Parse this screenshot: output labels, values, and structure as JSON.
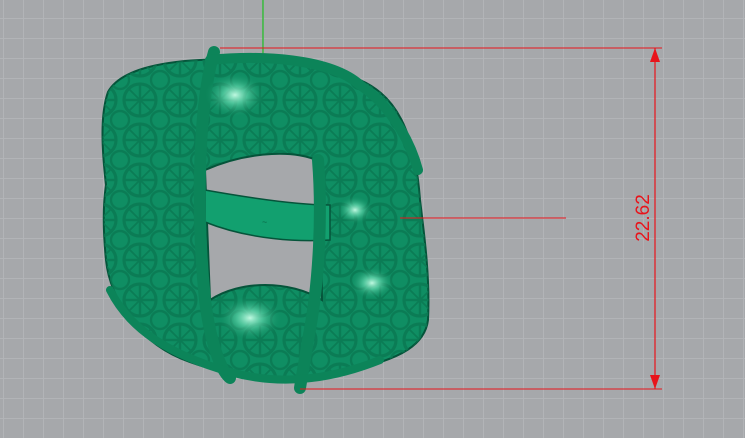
{
  "viewport": {
    "background_color": "#a6a8ab",
    "grid_minor_color": "#b2b4b7",
    "grid_major_color": "#9e9fa2"
  },
  "axis": {
    "y_axis_color": "#36b93a"
  },
  "model": {
    "name_icon": "ring-3d-model",
    "color": "#0f8e63",
    "highlight_color": "#6fe3b9",
    "shadow_color": "#04563b"
  },
  "dimension": {
    "value": "22.62",
    "color": "#e8141b"
  }
}
